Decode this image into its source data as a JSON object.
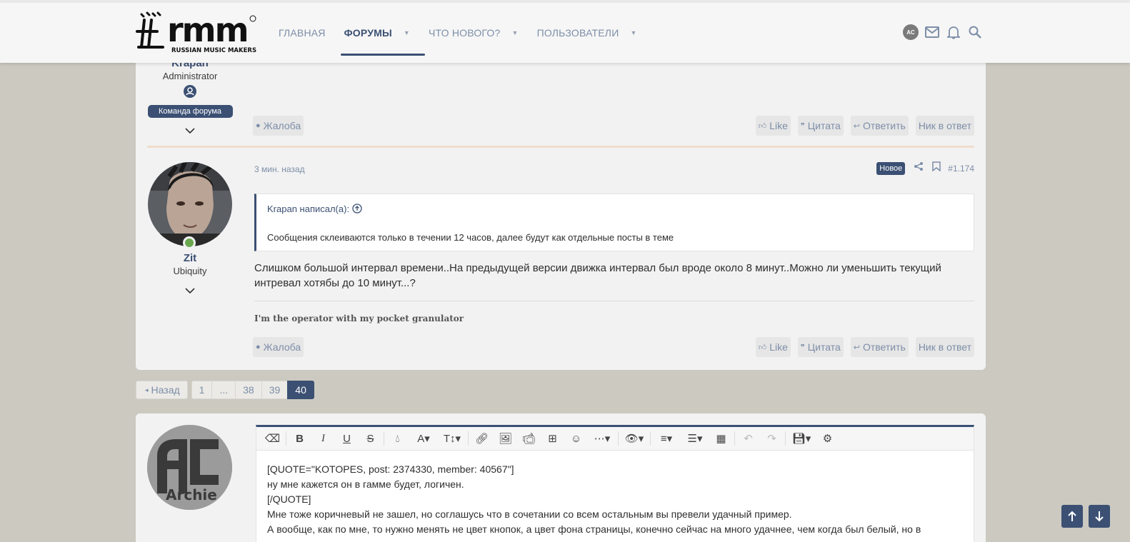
{
  "header": {
    "logo_alt": "rmm RUSSIAN MUSIC MAKERS",
    "logo_text": "rmm",
    "logo_subtext": "RUSSIAN MUSIC MAKERS",
    "nav": [
      {
        "label": "ГЛАВНАЯ",
        "active": false,
        "has_dropdown": false
      },
      {
        "label": "ФОРУМЫ",
        "active": true,
        "has_dropdown": true
      },
      {
        "label": "ЧТО НОВОГО?",
        "active": false,
        "has_dropdown": true
      },
      {
        "label": "ПОЛЬЗОВАТЕЛИ",
        "active": false,
        "has_dropdown": true
      }
    ],
    "user_avatar_text": "AC",
    "icons": [
      "mail-icon",
      "bell-icon",
      "search-icon"
    ]
  },
  "post1": {
    "username": "Krapan",
    "user_title": "Administrator",
    "staff_badge": "Команда форума",
    "report_label": "Жалоба",
    "actions": {
      "like": "Like",
      "quote": "Цитата",
      "reply": "Ответить",
      "nick": "Ник в ответ"
    }
  },
  "post2": {
    "username": "Zit",
    "user_title": "Ubiquity",
    "time": "3 мин. назад",
    "new_badge": "Новое",
    "post_number": "#1.174",
    "quote": {
      "author": "Krapan написал(а):",
      "text": "Сообщения склеиваются только в течении 12 часов, далее будут как отдельные посты в теме"
    },
    "body": "Слишком большой интервал времени..На предыдущей версии движка интервал был вроде около 8 минут..Можно ли уменьшить текущий интревал хотябы до 10 минут...?",
    "signature": "I'm the operator with my pocket granulator",
    "report_label": "Жалоба",
    "actions": {
      "like": "Like",
      "quote": "Цитата",
      "reply": "Ответить",
      "nick": "Ник в ответ"
    }
  },
  "pagination": {
    "prev": "Назад",
    "pages": [
      "1",
      "...",
      "38",
      "39",
      "40"
    ],
    "current": "40"
  },
  "reply": {
    "avatar_text": "Archie",
    "editor_lines": [
      "[QUOTE=\"KOTOPES, post: 2374330, member: 40567\"]",
      "ну мне кажется он в гамме будет, логичен.",
      "[/QUOTE]",
      "Мне тоже коричневый не зашел, но соглашусь что в сочетании со всем остальным вы превели удачный пример.",
      "А вообще, как по мне, то нужно менять не цвет кнопок, а цвет фона страницы, конечно сейчас на много удачнее, чем когда был белый, но в"
    ]
  },
  "colors": {
    "accent": "#3b5073",
    "background": "#ccc9c1",
    "panel": "#f2f2f2",
    "link": "#7d8ea8"
  }
}
